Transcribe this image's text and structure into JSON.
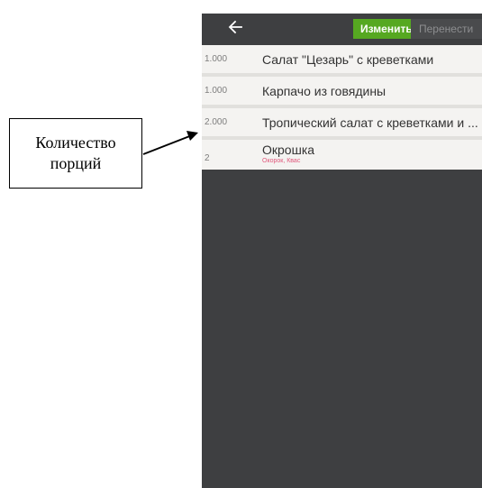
{
  "annotation": {
    "line1": "Количество",
    "line2": "порций"
  },
  "toolbar": {
    "back_icon": "arrow-left-icon",
    "edit_label": "Изменить",
    "move_label": "Перенести"
  },
  "colors": {
    "accent": "#56a821",
    "dark_bg": "#3e3f41",
    "row_bg": "#f4f3f1",
    "modifier": "#e0577b"
  },
  "order_items": [
    {
      "qty": "1.000",
      "name": "Салат \"Цезарь\" с креветками"
    },
    {
      "qty": "1.000",
      "name": "Карпачо из говядины"
    },
    {
      "qty": "2.000",
      "name": "Тропический салат с креветками и ..."
    },
    {
      "qty": "2",
      "name": "Окрошка",
      "modifiers": "Окорок, Квас"
    }
  ]
}
